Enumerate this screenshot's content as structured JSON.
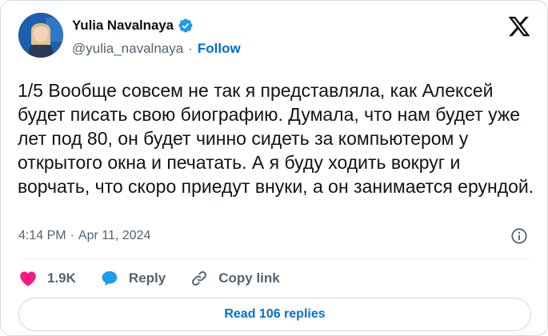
{
  "author": {
    "display_name": "Yulia Navalnaya",
    "handle": "@yulia_navalnaya",
    "separator": "·",
    "follow_label": "Follow",
    "verified_color": "#1d9bf0"
  },
  "tweet": {
    "text": "1/5 Вообще совсем не так я представляла, как Алексей будет писать свою биографию. Думала, что нам будет уже лет под 80, он будет чинно сидеть за компьютером у открытого окна и печатать. А я буду ходить вокруг и ворчать, что скоро приедут внуки, а он занимается ерундой.",
    "time": "4:14 PM",
    "separator": "·",
    "date": "Apr 11, 2024"
  },
  "actions": {
    "like_count": "1.9K",
    "reply_label": "Reply",
    "copy_link_label": "Copy link"
  },
  "footer": {
    "read_replies_label": "Read 106 replies"
  },
  "colors": {
    "accent": "#006fd6",
    "like": "#f91880",
    "reply_icon": "#1d9bf0",
    "muted": "#536471"
  }
}
